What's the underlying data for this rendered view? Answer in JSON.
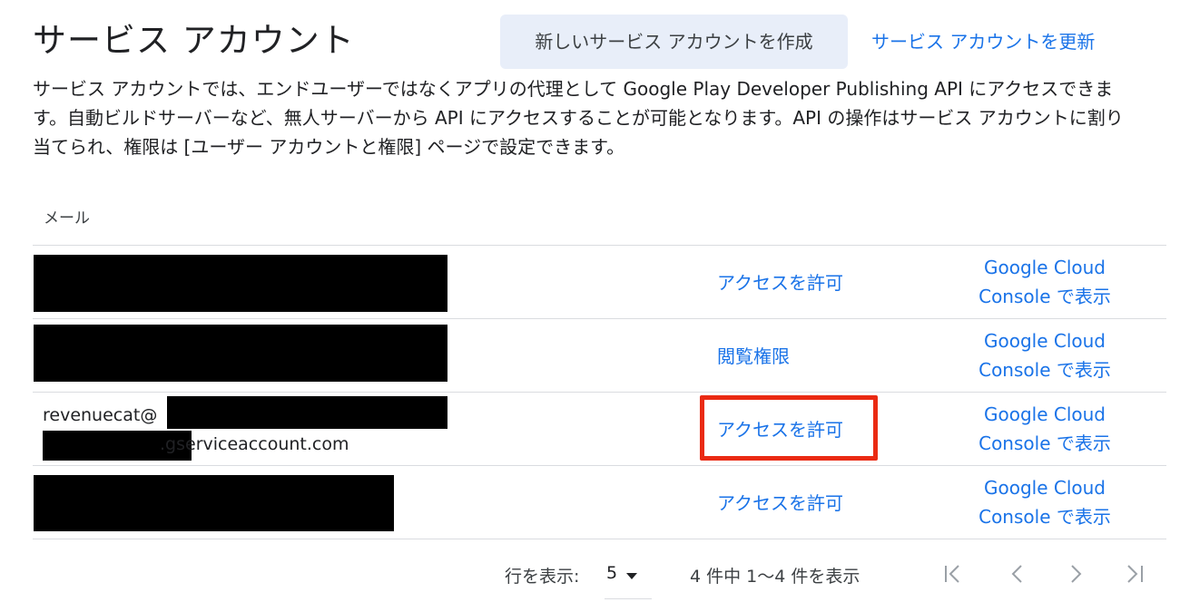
{
  "header": {
    "title": "サービス アカウント",
    "create_button": "新しいサービス アカウントを作成",
    "refresh_link": "サービス アカウントを更新"
  },
  "description": "サービス アカウントでは、エンドユーザーではなくアプリの代理として Google Play Developer Publishing API にアクセスできます。自動ビルドサーバーなど、無人サーバーから API にアクセスすることが可能となります。API の操作はサービス アカウントに割り当てられ、権限は [ユーザー アカウントと権限] ページで設定できます。",
  "table": {
    "column_email": "メール",
    "rows": [
      {
        "email_prefix": "",
        "email_suffix": "",
        "action": "アクセスを許可",
        "console_line1": "Google Cloud",
        "console_line2": "Console で表示"
      },
      {
        "email_prefix": "",
        "email_suffix": "",
        "action": "閲覧権限",
        "console_line1": "Google Cloud",
        "console_line2": "Console で表示"
      },
      {
        "email_prefix": "revenuecat@",
        "email_suffix": ".gserviceaccount.com",
        "action": "アクセスを許可",
        "console_line1": "Google Cloud",
        "console_line2": "Console で表示",
        "highlighted": true
      },
      {
        "email_prefix": "",
        "email_suffix": "",
        "action": "アクセスを許可",
        "console_line1": "Google Cloud",
        "console_line2": "Console で表示"
      }
    ]
  },
  "pagination": {
    "rows_label": "行を表示:",
    "rows_value": "5",
    "range_text": "4 件中 1〜4 件を表示",
    "icons": [
      "first-page-icon",
      "previous-page-icon",
      "next-page-icon",
      "last-page-icon"
    ]
  },
  "colors": {
    "link": "#1a73e8",
    "highlight": "#ea2a13",
    "create_button_bg": "#e8eef9"
  }
}
